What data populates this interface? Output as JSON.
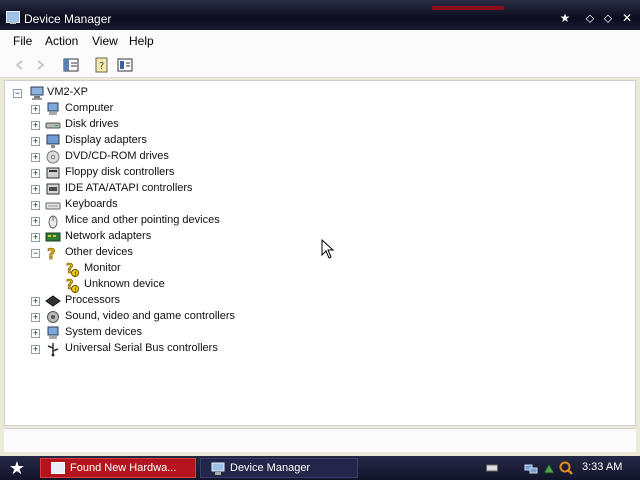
{
  "window": {
    "title": "Device Manager"
  },
  "menubar": {
    "items": [
      {
        "label": "File"
      },
      {
        "label": "Action"
      },
      {
        "label": "View"
      },
      {
        "label": "Help"
      }
    ]
  },
  "tree": {
    "root": {
      "label": "VM2-XP",
      "icon": "computer-icon"
    },
    "items": [
      {
        "label": "Computer",
        "icon": "computer-icon",
        "expanded": false
      },
      {
        "label": "Disk drives",
        "icon": "disk-drive-icon",
        "expanded": false
      },
      {
        "label": "Display adapters",
        "icon": "display-adapter-icon",
        "expanded": false
      },
      {
        "label": "DVD/CD-ROM drives",
        "icon": "cd-drive-icon",
        "expanded": false
      },
      {
        "label": "Floppy disk controllers",
        "icon": "floppy-controller-icon",
        "expanded": false
      },
      {
        "label": "IDE ATA/ATAPI controllers",
        "icon": "ide-controller-icon",
        "expanded": false
      },
      {
        "label": "Keyboards",
        "icon": "keyboard-icon",
        "expanded": false
      },
      {
        "label": "Mice and other pointing devices",
        "icon": "mouse-icon",
        "expanded": false
      },
      {
        "label": "Network adapters",
        "icon": "network-adapter-icon",
        "expanded": false
      },
      {
        "label": "Other devices",
        "icon": "unknown-device-icon",
        "expanded": true,
        "children": [
          {
            "label": "Monitor",
            "icon": "warning-device-icon"
          },
          {
            "label": "Unknown device",
            "icon": "warning-device-icon"
          }
        ]
      },
      {
        "label": "Processors",
        "icon": "processor-icon",
        "expanded": false
      },
      {
        "label": "Sound, video and game controllers",
        "icon": "sound-icon",
        "expanded": false
      },
      {
        "label": "System devices",
        "icon": "system-device-icon",
        "expanded": false
      },
      {
        "label": "Universal Serial Bus controllers",
        "icon": "usb-icon",
        "expanded": false
      }
    ]
  },
  "taskbar": {
    "tasks": [
      {
        "label": "Found New Hardwa..."
      },
      {
        "label": "Device Manager"
      }
    ],
    "clock": "3:33 AM"
  },
  "colors": {
    "taskbar_active": "#b3141e",
    "titlebar": "#0b0c1e"
  }
}
